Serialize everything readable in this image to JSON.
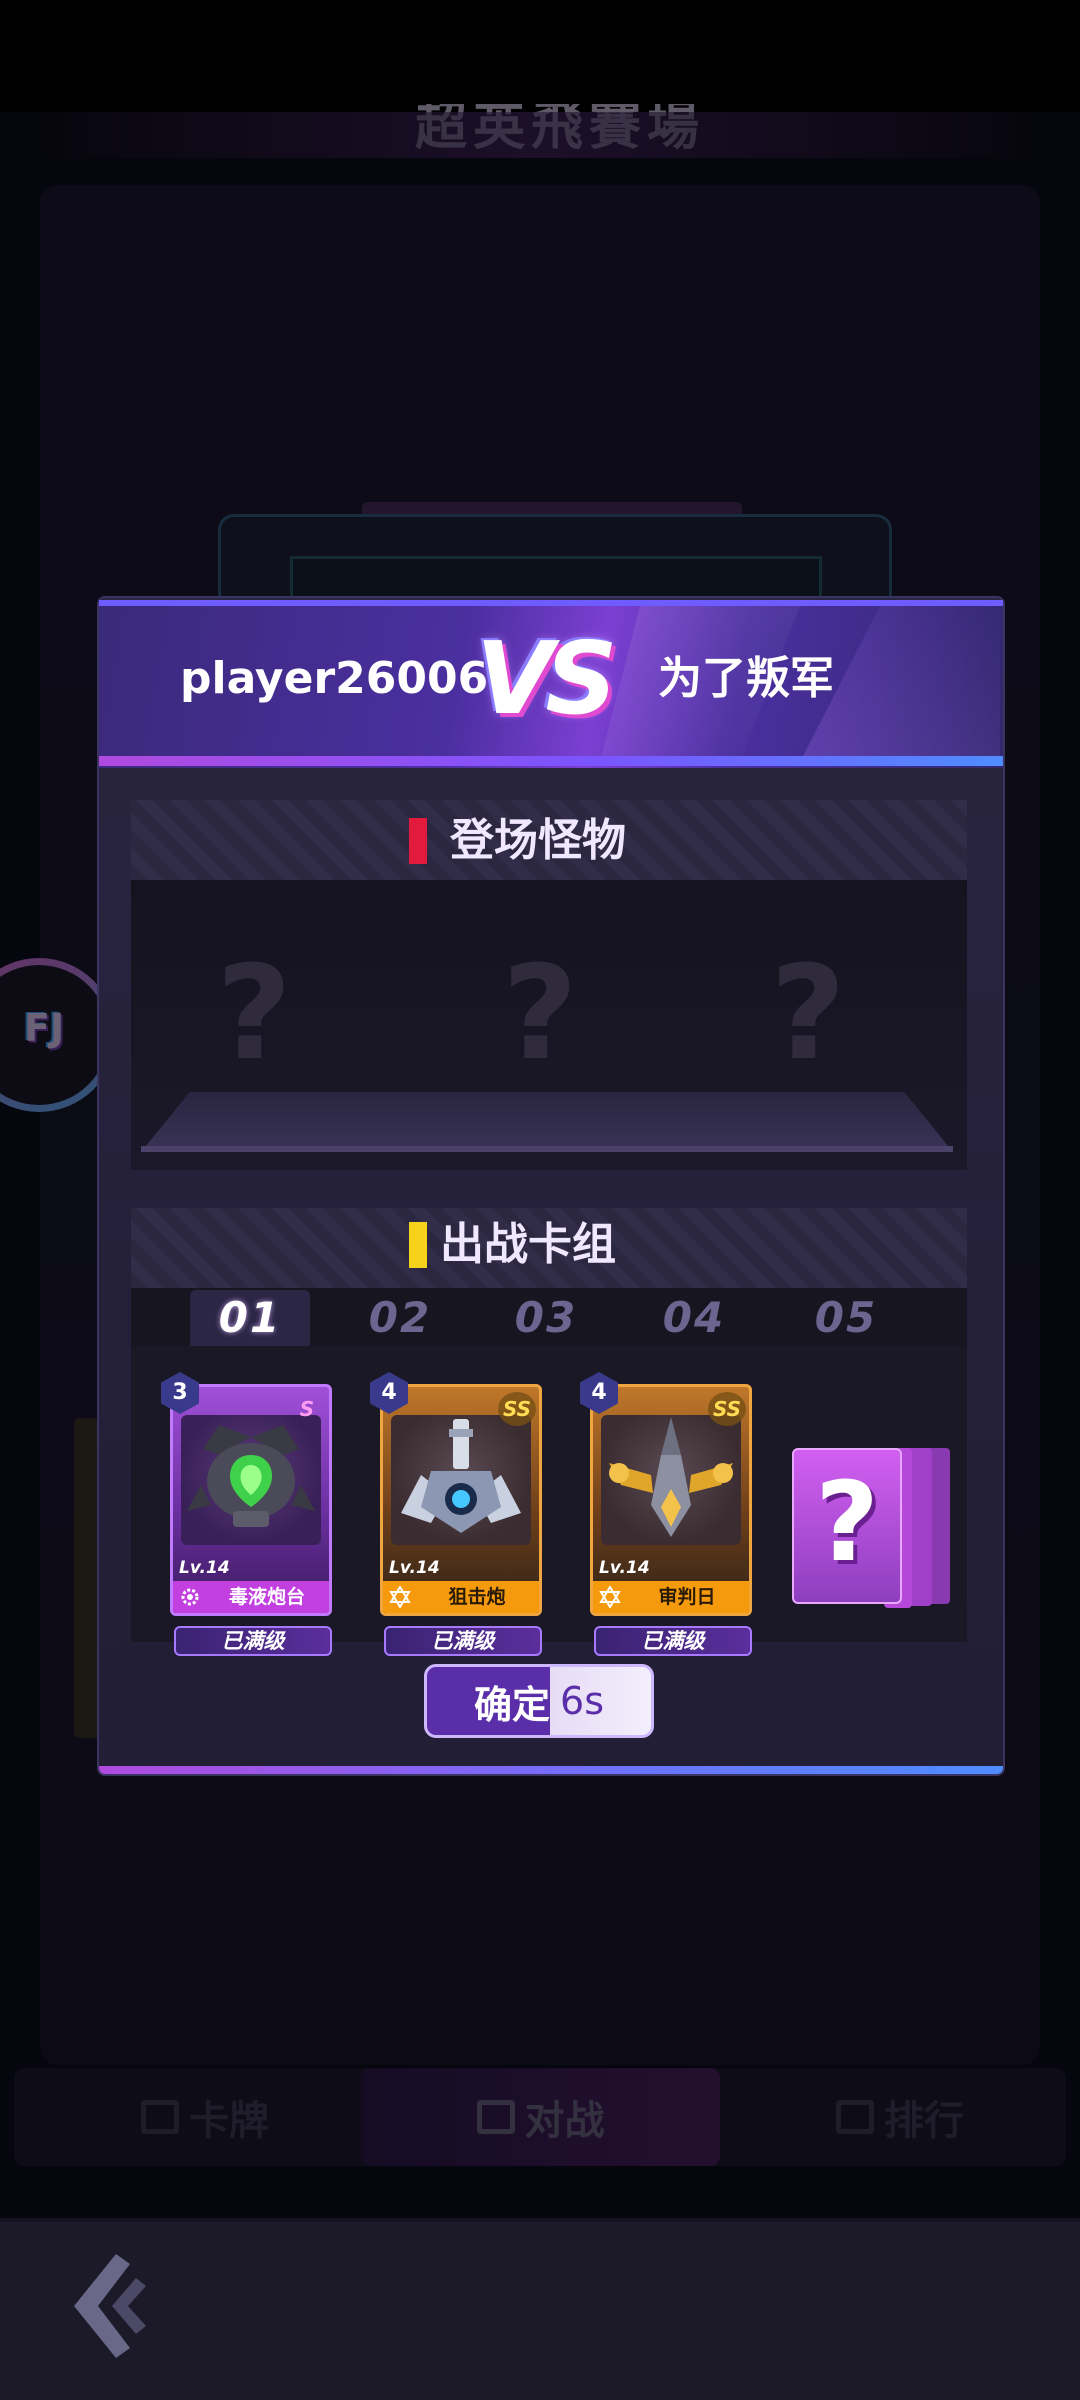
{
  "background": {
    "title": "超英飛賽場",
    "tabs": [
      {
        "label": "卡牌",
        "icon": "cards-icon"
      },
      {
        "label": "对战",
        "icon": "battle-icon"
      },
      {
        "label": "排行",
        "icon": "ranking-icon"
      }
    ],
    "side_badge": "FJ",
    "back_icon": "back-arrow-icon"
  },
  "dialog": {
    "player_left": "player26006",
    "vs": "VS",
    "player_right": "为了叛军",
    "monster_section": {
      "title": "登场怪物",
      "slots": [
        "?",
        "?",
        "?"
      ]
    },
    "deck_section": {
      "title": "出战卡组",
      "tabs": [
        "01",
        "02",
        "03",
        "04",
        "05"
      ],
      "active_tab": "01",
      "cards": [
        {
          "star": "3",
          "rarity": "S",
          "level": "Lv.14",
          "name": "毒液炮台",
          "status": "已满级"
        },
        {
          "star": "4",
          "rarity": "SS",
          "level": "Lv.14",
          "name": "狙击炮",
          "status": "已满级"
        },
        {
          "star": "4",
          "rarity": "SS",
          "level": "Lv.14",
          "name": "审判日",
          "status": "已满级"
        }
      ],
      "locked_card": "?"
    },
    "confirm": {
      "label": "确定",
      "timer": "6s"
    }
  },
  "colors": {
    "accent_purple": "#7c3fd2",
    "accent_blue": "#4f8dff",
    "monster_marker": "#e21b3c",
    "deck_marker": "#f6d21b",
    "rarity_orange": "#f59a0c"
  }
}
